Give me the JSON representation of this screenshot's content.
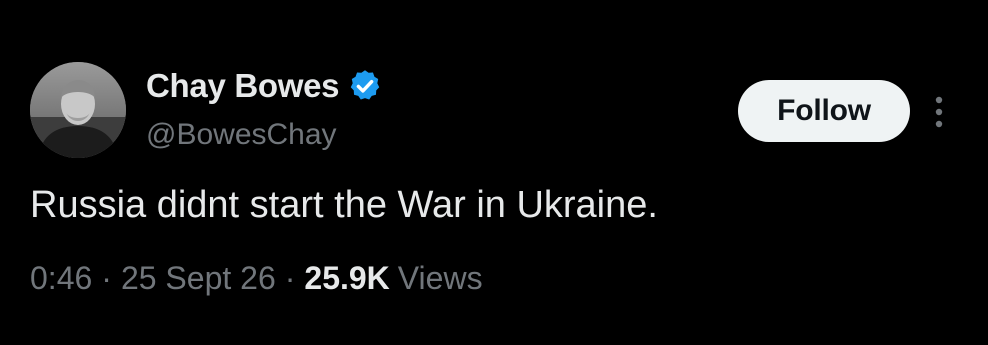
{
  "user": {
    "display_name": "Chay Bowes",
    "handle": "@BowesChay",
    "verified": true,
    "avatar_icon": "profile-photo"
  },
  "actions": {
    "follow_label": "Follow",
    "more_icon": "more-vertical-icon"
  },
  "tweet": {
    "text": "Russia didnt start the War in Ukraine."
  },
  "meta": {
    "time": "0:46",
    "separator": "·",
    "date": "25 Sept 26",
    "views_count": "25.9K",
    "views_label": "Views"
  },
  "colors": {
    "background": "#000000",
    "primary_text": "#e7e9ea",
    "secondary_text": "#71767b",
    "verified_badge": "#1d9bf0",
    "follow_button_bg": "#eff3f4",
    "follow_button_text": "#0f1419"
  }
}
